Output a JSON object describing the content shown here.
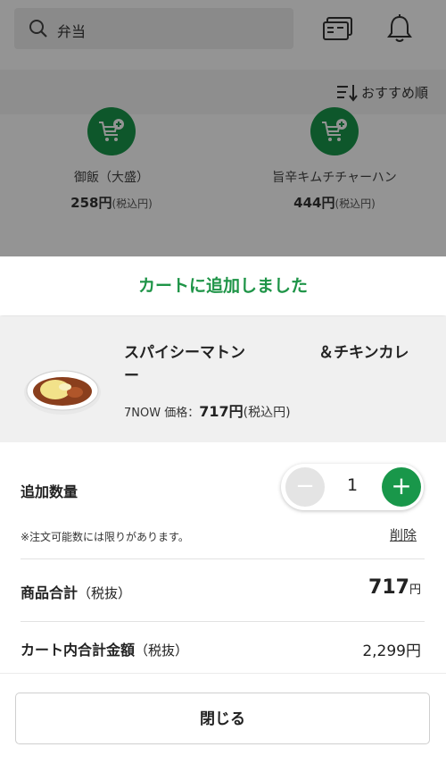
{
  "search": {
    "value": "弁当"
  },
  "sort": {
    "label": "おすすめ順"
  },
  "products": [
    {
      "name": "御飯（大盛）",
      "price": "258円",
      "tax": "(税込円)"
    },
    {
      "name": "旨辛キムチチャーハン",
      "price": "444円",
      "tax": "(税込円)"
    }
  ],
  "sheet": {
    "title": "カートに追加しました",
    "item": {
      "name_line1": "スパイシーマトン",
      "name_line1b": "＆チキンカレ",
      "name_line2": "ー",
      "price_prefix": "7NOW 価格：",
      "price": "717円",
      "price_tax": "(税込円)"
    },
    "quantity": {
      "label": "追加数量",
      "value": "1",
      "minus": "−",
      "plus": "+"
    },
    "note": "※注文可能数には限りがあります。",
    "delete_label": "削除",
    "subtotal": {
      "label": "商品合計",
      "label_sub": "（税抜）",
      "value": "717",
      "unit": "円"
    },
    "cart_total": {
      "label": "カート内合計金額",
      "label_sub": "（税抜）",
      "value": "2,299円"
    },
    "close_label": "閉じる"
  },
  "colors": {
    "accent": "#19974a",
    "title_green": "#1e9447"
  }
}
